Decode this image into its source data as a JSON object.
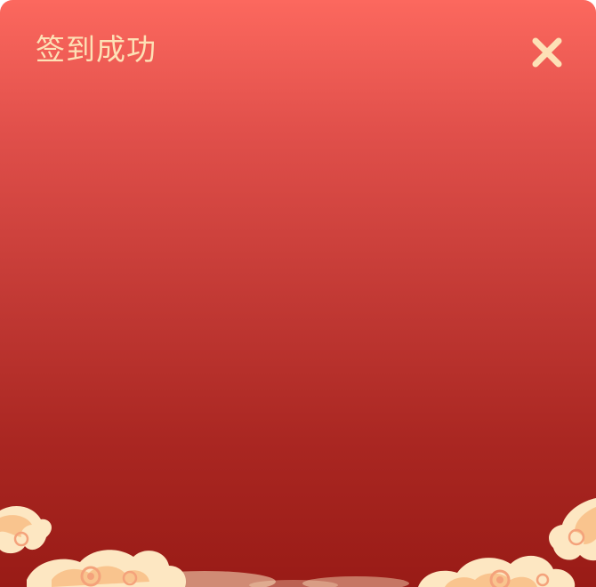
{
  "dialog": {
    "title": "签到成功",
    "close_icon": "close-icon",
    "decoration_icon": "auspicious-cloud-icon"
  },
  "colors": {
    "gradient_top": "#fc685e",
    "gradient_bottom": "#991b16",
    "title_text": "#fde1b6",
    "close_icon": "#fde1b6",
    "cloud_light": "#fde7c2",
    "cloud_mid": "#f9c48e",
    "cloud_accent": "#f4a27b"
  }
}
